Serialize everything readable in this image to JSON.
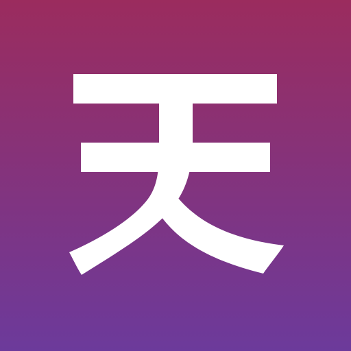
{
  "app_icon": {
    "glyph_text": "天",
    "icon": "tian-glyph-icon",
    "colors": {
      "gradient_top": "#9B2C5E",
      "gradient_bottom": "#6C3A9B",
      "glyph": "#FFFFFF"
    }
  }
}
